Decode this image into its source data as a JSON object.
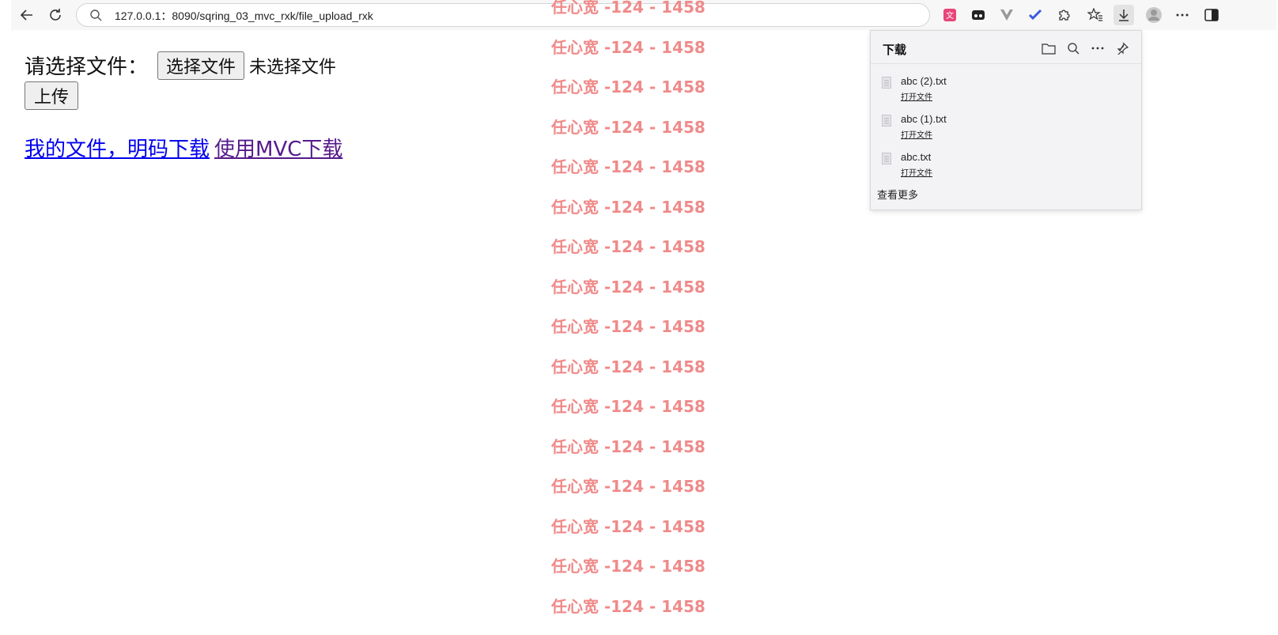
{
  "browser": {
    "url": "127.0.0.1：8090/sqring_03_mvc_rxk/file_upload_rxk"
  },
  "page": {
    "select_label": "请选择文件：",
    "choose_button": "选择文件",
    "no_file_text": "未选择文件",
    "upload_button": "上传",
    "link_plain_download": "我的文件，明码下载",
    "link_mvc_download": "使用MVC下载"
  },
  "watermark": {
    "text": "任心宽 -124 - 1458",
    "repeat_count": 16
  },
  "downloads": {
    "title": "下载",
    "items": [
      {
        "name": "abc (2).txt",
        "action": "打开文件"
      },
      {
        "name": "abc (1).txt",
        "action": "打开文件"
      },
      {
        "name": "abc.txt",
        "action": "打开文件"
      }
    ],
    "see_more": "查看更多"
  },
  "colors": {
    "link_unvisited": "#0000ee",
    "link_visited": "#551a8b",
    "watermark": "#f08a8a"
  }
}
